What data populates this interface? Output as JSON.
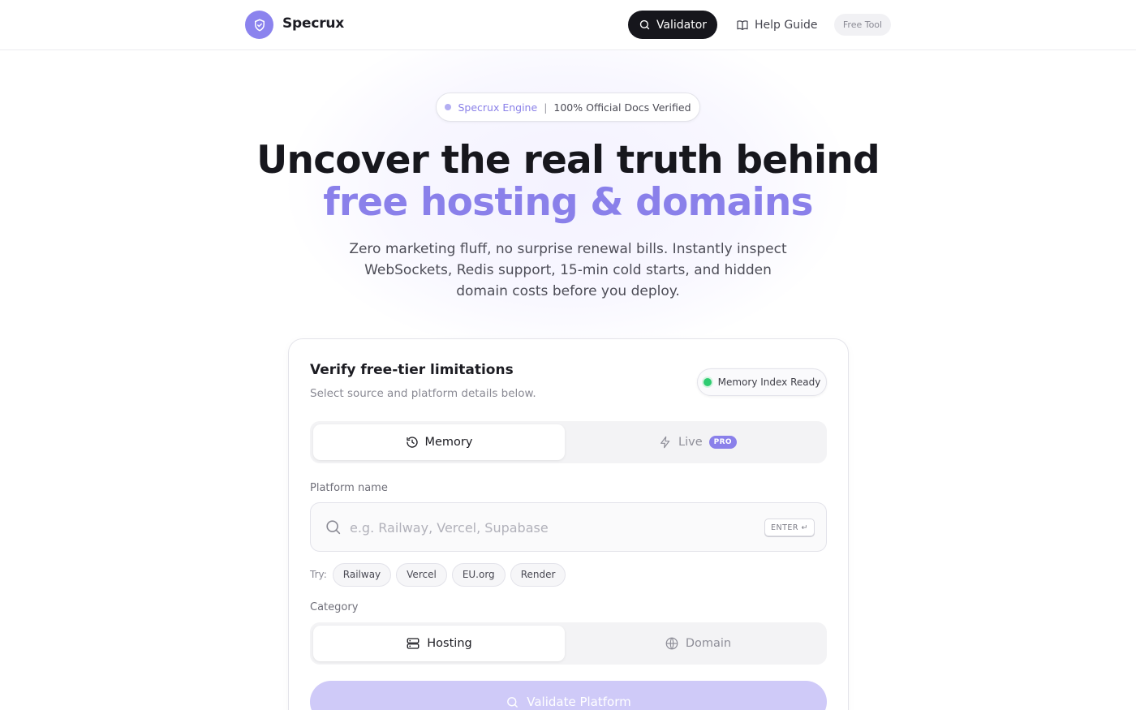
{
  "header": {
    "brand": "Specrux",
    "nav": {
      "validator": "Validator",
      "help_guide": "Help Guide",
      "free_tool": "Free Tool"
    }
  },
  "hero": {
    "pill": {
      "engine": "Specrux Engine",
      "separator": "|",
      "verified": "100% Official Docs Verified"
    },
    "title_line1": "Uncover the real truth behind",
    "title_line2": "free hosting & domains",
    "subtitle": "Zero marketing fluff, no surprise renewal bills. Instantly inspect WebSockets, Redis support, 15-min cold starts, and hidden domain costs before you deploy."
  },
  "card": {
    "title": "Verify free-tier limitations",
    "subtitle": "Select source and platform details below.",
    "status": "Memory Index Ready",
    "mode_tabs": [
      {
        "label": "Memory",
        "icon": "history-icon",
        "active": true
      },
      {
        "label": "Live",
        "icon": "bolt-icon",
        "active": false,
        "badge": "PRO"
      }
    ],
    "platform_label": "Platform name",
    "search": {
      "placeholder": "e.g. Railway, Vercel, Supabase",
      "value": "",
      "shortcut": "ENTER ↵"
    },
    "try": {
      "label": "Try:",
      "chips": [
        "Railway",
        "Vercel",
        "EU.org",
        "Render"
      ]
    },
    "category_label": "Category",
    "category_tabs": [
      {
        "label": "Hosting",
        "icon": "server-icon",
        "active": true
      },
      {
        "label": "Domain",
        "icon": "globe-icon",
        "active": false
      }
    ],
    "validate_button": "Validate Platform"
  },
  "colors": {
    "accent": "#8a80ea",
    "dark_button": "#16161c",
    "status_green": "#2ecc71",
    "validate_disabled": "#cfcaf8"
  }
}
